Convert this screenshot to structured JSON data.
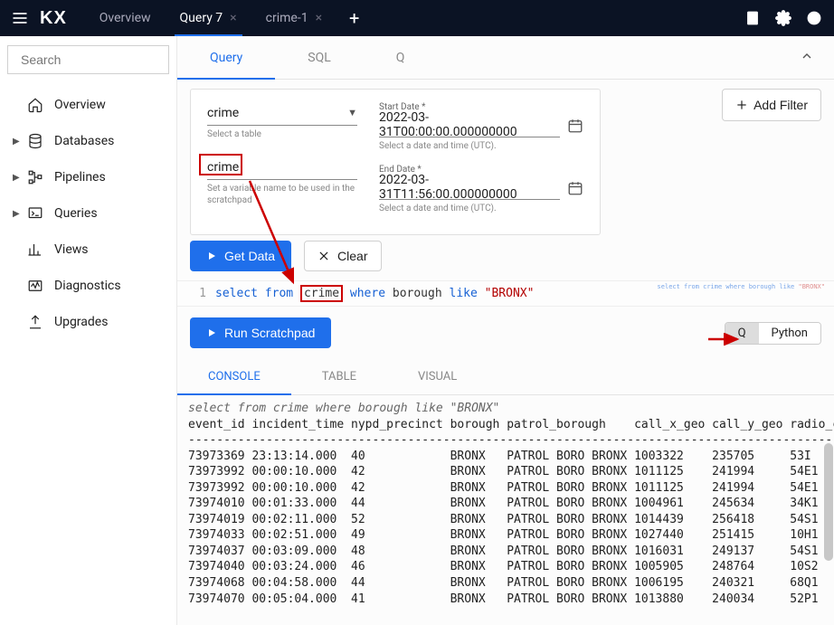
{
  "topbar": {
    "logo": "KX",
    "tabs": [
      {
        "label": "Overview",
        "closable": false,
        "active": false
      },
      {
        "label": "Query 7",
        "closable": true,
        "active": true
      },
      {
        "label": "crime-1",
        "closable": true,
        "active": false
      }
    ]
  },
  "sidebar": {
    "search_placeholder": "Search",
    "items": [
      {
        "label": "Overview",
        "icon": "home",
        "expandable": false
      },
      {
        "label": "Databases",
        "icon": "database",
        "expandable": true
      },
      {
        "label": "Pipelines",
        "icon": "pipeline",
        "expandable": true
      },
      {
        "label": "Queries",
        "icon": "query",
        "expandable": true
      },
      {
        "label": "Views",
        "icon": "views",
        "expandable": false
      },
      {
        "label": "Diagnostics",
        "icon": "diagnostics",
        "expandable": false
      },
      {
        "label": "Upgrades",
        "icon": "upgrades",
        "expandable": false
      }
    ]
  },
  "qtabs": [
    {
      "label": "Query",
      "active": true
    },
    {
      "label": "SQL",
      "active": false
    },
    {
      "label": "Q",
      "active": false
    }
  ],
  "form": {
    "table_value": "crime",
    "table_helper": "Select a table",
    "var_value": "crime",
    "var_helper": "Set a variable name to be used in the scratchpad",
    "start_label": "Start Date *",
    "start_value": "2022-03-31T00:00:00.000000000",
    "start_helper": "Select a date and time (UTC).",
    "end_label": "End Date *",
    "end_value": "2022-03-31T11:56:00.000000000",
    "end_helper": "Select a date and time (UTC).",
    "add_filter": "Add Filter"
  },
  "actions": {
    "get_data": "Get Data",
    "clear": "Clear",
    "run_scratchpad": "Run Scratchpad"
  },
  "code": {
    "line_no": "1",
    "kw1": "select",
    "kw2": "from",
    "tbl": "crime",
    "kw3": "where",
    "col": "borough",
    "kw4": "like",
    "str": "\"BRONX\"",
    "mini": "select from crime where borough like",
    "mini_str": "\"BRONX\""
  },
  "lang_toggle": {
    "q": "Q",
    "python": "Python",
    "active": "Q"
  },
  "otabs": [
    {
      "label": "CONSOLE",
      "active": true
    },
    {
      "label": "TABLE",
      "active": false
    },
    {
      "label": "VISUAL",
      "active": false
    }
  ],
  "console": {
    "echo": "select from crime where borough like \"BRONX\"",
    "header": "event_id incident_time nypd_precinct borough patrol_borough    call_x_geo call_y_geo radio_co",
    "divider": "--------------------------------------------------------------------------------------------------",
    "rows": [
      "73973369 23:13:14.000  40            BRONX   PATROL BORO BRONX 1003322    235705     53I",
      "73973992 00:00:10.000  42            BRONX   PATROL BORO BRONX 1011125    241994     54E1",
      "73973992 00:00:10.000  42            BRONX   PATROL BORO BRONX 1011125    241994     54E1",
      "73974010 00:01:33.000  44            BRONX   PATROL BORO BRONX 1004961    245634     34K1",
      "73974019 00:02:11.000  52            BRONX   PATROL BORO BRONX 1014439    256418     54S1",
      "73974033 00:02:51.000  49            BRONX   PATROL BORO BRONX 1027440    251415     10H1",
      "73974037 00:03:09.000  48            BRONX   PATROL BORO BRONX 1016031    249137     54S1",
      "73974040 00:03:24.000  46            BRONX   PATROL BORO BRONX 1005905    248764     10S2",
      "73974068 00:04:58.000  44            BRONX   PATROL BORO BRONX 1006195    240321     68Q1",
      "73974070 00:05:04.000  41            BRONX   PATROL BORO BRONX 1013880    240034     52P1"
    ]
  }
}
